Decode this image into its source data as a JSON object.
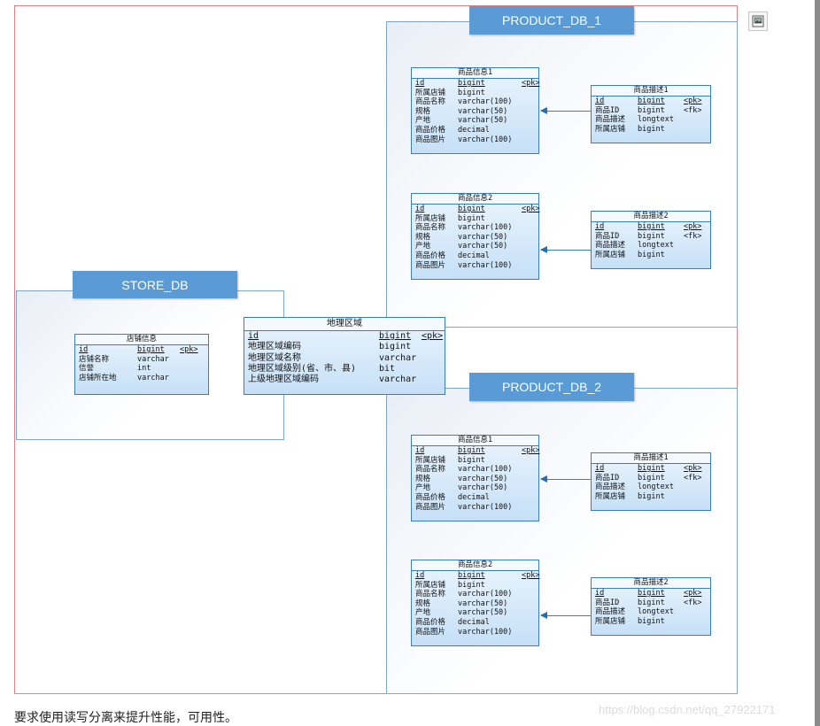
{
  "regions": {
    "product_db_1": "PRODUCT_DB_1",
    "product_db_2": "PRODUCT_DB_2",
    "store_db": "STORE_DB"
  },
  "product_info_1": {
    "title": "商品信息1",
    "rows": [
      {
        "name": "id",
        "type": "bigint",
        "key": "<pk>"
      },
      {
        "name": "所属店铺",
        "type": "bigint",
        "key": ""
      },
      {
        "name": "商品名称",
        "type": "varchar(100)",
        "key": ""
      },
      {
        "name": "规格",
        "type": "varchar(50)",
        "key": ""
      },
      {
        "name": "产地",
        "type": "varchar(50)",
        "key": ""
      },
      {
        "name": "商品价格",
        "type": "decimal",
        "key": ""
      },
      {
        "name": "商品图片",
        "type": "varchar(100)",
        "key": ""
      }
    ]
  },
  "product_info_2": {
    "title": "商品信息2",
    "rows": [
      {
        "name": "id",
        "type": "bigint",
        "key": "<pk>"
      },
      {
        "name": "所属店铺",
        "type": "bigint",
        "key": ""
      },
      {
        "name": "商品名称",
        "type": "varchar(100)",
        "key": ""
      },
      {
        "name": "规格",
        "type": "varchar(50)",
        "key": ""
      },
      {
        "name": "产地",
        "type": "varchar(50)",
        "key": ""
      },
      {
        "name": "商品价格",
        "type": "decimal",
        "key": ""
      },
      {
        "name": "商品图片",
        "type": "varchar(100)",
        "key": ""
      }
    ]
  },
  "product_desc_1": {
    "title": "商品描述1",
    "rows": [
      {
        "name": "id",
        "type": "bigint",
        "key": "<pk>"
      },
      {
        "name": "商品ID",
        "type": "bigint",
        "key": "<fk>"
      },
      {
        "name": "商品描述",
        "type": "longtext",
        "key": ""
      },
      {
        "name": "所属店铺",
        "type": "bigint",
        "key": ""
      }
    ]
  },
  "product_desc_2": {
    "title": "商品描述2",
    "rows": [
      {
        "name": "id",
        "type": "bigint",
        "key": "<pk>"
      },
      {
        "name": "商品ID",
        "type": "bigint",
        "key": "<fk>"
      },
      {
        "name": "商品描述",
        "type": "longtext",
        "key": ""
      },
      {
        "name": "所属店铺",
        "type": "bigint",
        "key": ""
      }
    ]
  },
  "store_info": {
    "title": "店铺信息",
    "rows": [
      {
        "name": "id",
        "type": "bigint",
        "key": "<pk>"
      },
      {
        "name": "店铺名称",
        "type": "varchar",
        "key": ""
      },
      {
        "name": "信誉",
        "type": "int",
        "key": ""
      },
      {
        "name": "店铺所在地",
        "type": "varchar",
        "key": ""
      }
    ]
  },
  "region_area": {
    "title": "地理区域",
    "rows": [
      {
        "name": "id",
        "type": "bigint",
        "key": "<pk>"
      },
      {
        "name": "地理区域编码",
        "type": "bigint",
        "key": ""
      },
      {
        "name": "地理区域名称",
        "type": "varchar",
        "key": ""
      },
      {
        "name": "地理区域级别(省、市、县)",
        "type": "bit",
        "key": ""
      },
      {
        "name": "上级地理区域编码",
        "type": "varchar",
        "key": ""
      }
    ]
  },
  "caption": "要求使用读写分离来提升性能，可用性。",
  "watermark": "https://blog.csdn.net/qq_27922171",
  "toolbar_icon": "image-icon",
  "colors": {
    "region_title_bg": "#5b9bd5",
    "table_border": "#3b7fb9",
    "frame_border": "#d9848b"
  }
}
